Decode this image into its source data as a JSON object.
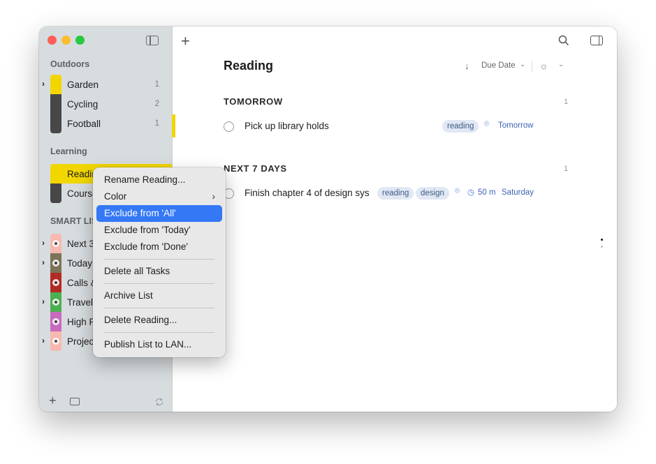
{
  "window": {
    "sidebar_toggle_icon": "sidebar-icon",
    "colors": {
      "close": "#ff5f57",
      "minimize": "#febc2e",
      "zoom": "#28c840"
    }
  },
  "sidebar": {
    "sections": [
      {
        "title": "Outdoors"
      },
      {
        "title": "Learning"
      },
      {
        "title": "SMART LIS"
      }
    ],
    "outdoors": [
      {
        "label": "Garden",
        "count": "1",
        "color": "#f2d600",
        "expandable": true
      },
      {
        "label": "Cycling",
        "count": "2",
        "color": "#474747",
        "expandable": false
      },
      {
        "label": "Football",
        "count": "1",
        "color": "#474747",
        "expandable": false
      }
    ],
    "learning": [
      {
        "label": "Readir",
        "color": "#f2d600",
        "selected": true
      },
      {
        "label": "Course",
        "color": "#474747"
      }
    ],
    "smart": [
      {
        "label": "Next 3",
        "color": "#f6b8b0",
        "expandable": true
      },
      {
        "label": "Today",
        "color": "#7d7358",
        "expandable": true
      },
      {
        "label": "Calls &",
        "color": "#b22a24",
        "expandable": false
      },
      {
        "label": "Travel",
        "color": "#4cb050",
        "expandable": true
      },
      {
        "label": "High P",
        "color": "#c76bbf",
        "expandable": false
      },
      {
        "label": "Projec",
        "color": "#f6b8b0",
        "expandable": true
      }
    ],
    "bottom": {
      "add_icon": "plus-icon",
      "calendar_icon": "calendar-icon",
      "sync_icon": "sync-icon"
    }
  },
  "toolbar": {
    "add_icon": "plus-icon",
    "search_icon": "search-icon",
    "inspector_icon": "inspector-icon"
  },
  "list": {
    "title": "Reading",
    "sort_label": "Due Date",
    "sort_icon": "arrow-down-icon",
    "view_icon": "sun-icon",
    "accent": "#f2d600"
  },
  "groups": [
    {
      "title": "TOMORROW",
      "count": "1",
      "tasks": [
        {
          "title": "Pick up library holds",
          "tags": [
            "reading"
          ],
          "location_icon": "location-pin-icon",
          "due": "Tomorrow"
        }
      ]
    },
    {
      "title": "NEXT 7 DAYS",
      "count": "1",
      "tasks": [
        {
          "title": "Finish chapter 4 of design sys",
          "tags": [
            "reading",
            "design"
          ],
          "location_icon": "location-pin-icon",
          "duration_icon": "clock-icon",
          "duration": "50 m",
          "due": "Saturday"
        }
      ]
    }
  ],
  "context_menu": {
    "items": [
      {
        "label": "Rename Reading..."
      },
      {
        "label": "Color",
        "submenu_icon": "chevron-right-icon"
      },
      {
        "label": "Exclude from 'All'",
        "highlighted": true
      },
      {
        "label": "Exclude from 'Today'"
      },
      {
        "label": "Exclude from 'Done'"
      },
      {
        "label": "Delete all Tasks"
      },
      {
        "label": "Archive List"
      },
      {
        "label": "Delete Reading..."
      },
      {
        "label": "Publish List to LAN..."
      }
    ],
    "highlight_color": "#3478f6"
  }
}
